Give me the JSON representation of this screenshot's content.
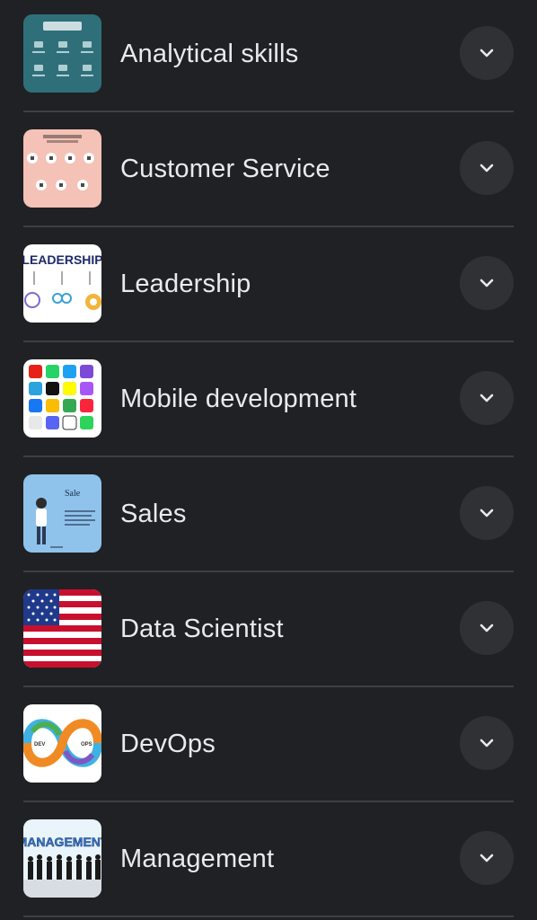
{
  "items": [
    {
      "label": "Analytical skills",
      "thumbnail": "analytical-skills-thumbnail",
      "expand_icon": "chevron-down-icon"
    },
    {
      "label": "Customer Service",
      "thumbnail": "customer-service-thumbnail",
      "expand_icon": "chevron-down-icon"
    },
    {
      "label": "Leadership",
      "thumbnail": "leadership-thumbnail",
      "thumbnail_text": "LEADERSHIP",
      "expand_icon": "chevron-down-icon"
    },
    {
      "label": "Mobile development",
      "thumbnail": "app-icons-grid-thumbnail",
      "expand_icon": "chevron-down-icon"
    },
    {
      "label": "Sales",
      "thumbnail": "sales-thumbnail",
      "thumbnail_text": "Sale",
      "expand_icon": "chevron-down-icon"
    },
    {
      "label": "Data Scientist",
      "thumbnail": "us-flag-thumbnail",
      "expand_icon": "chevron-down-icon"
    },
    {
      "label": "DevOps",
      "thumbnail": "devops-infinity-thumbnail",
      "thumbnail_text": [
        "DEV",
        "OPS"
      ],
      "expand_icon": "chevron-down-icon"
    },
    {
      "label": "Management",
      "thumbnail": "management-thumbnail",
      "thumbnail_text": "MANAGEMENT",
      "expand_icon": "chevron-down-icon"
    }
  ],
  "colors": {
    "background": "#202124",
    "text": "#e8eaed",
    "button_bg": "#303134",
    "divider": "#3c4043"
  }
}
